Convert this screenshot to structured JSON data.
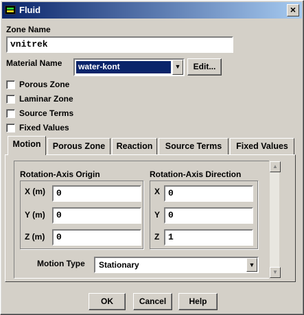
{
  "window": {
    "title": "Fluid",
    "close": "×"
  },
  "zone": {
    "label": "Zone Name",
    "value": "vnitrek"
  },
  "material": {
    "label": "Material Name",
    "value": "water-kont",
    "edit_label": "Edit..."
  },
  "checkboxes": [
    "Porous Zone",
    "Laminar Zone",
    "Source Terms",
    "Fixed Values"
  ],
  "tabs": [
    "Motion",
    "Porous Zone",
    "Reaction",
    "Source Terms",
    "Fixed Values"
  ],
  "motion": {
    "origin": {
      "title": "Rotation-Axis Origin",
      "x_label": "X (m)",
      "x": "0",
      "y_label": "Y (m)",
      "y": "0",
      "z_label": "Z (m)",
      "z": "0"
    },
    "direction": {
      "title": "Rotation-Axis Direction",
      "x_label": "X",
      "x": "0",
      "y_label": "Y",
      "y": "0",
      "z_label": "Z",
      "z": "1"
    },
    "motion_type_label": "Motion Type",
    "motion_type_value": "Stationary"
  },
  "buttons": {
    "ok": "OK",
    "cancel": "Cancel",
    "help": "Help"
  },
  "icons": {
    "window": "fluent-window-icon",
    "dropdown": "chevron-down-icon"
  }
}
